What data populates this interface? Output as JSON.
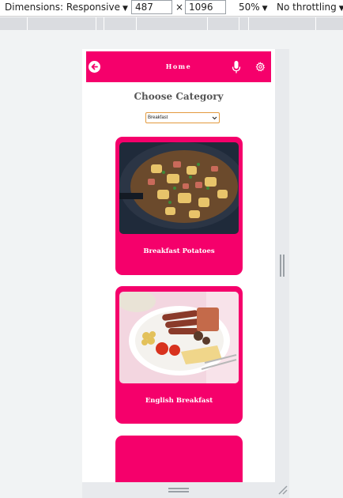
{
  "devtools": {
    "dimensions_label": "Dimensions: Responsive",
    "width_value": "487",
    "times": "×",
    "height_value": "1096",
    "zoom": "50%",
    "throttling": "No throttling",
    "caret": "▼"
  },
  "app": {
    "header_title": "Home",
    "accent_color": "#f5006b",
    "choose_title": "Choose Category",
    "category_selected": "Breakfast",
    "recipes": [
      {
        "name": "Breakfast Potatoes"
      },
      {
        "name": "English Breakfast"
      },
      {
        "name": ""
      }
    ]
  },
  "icons": {
    "back": "back-arrow-icon",
    "mic": "microphone-icon",
    "settings": "gear-icon"
  }
}
